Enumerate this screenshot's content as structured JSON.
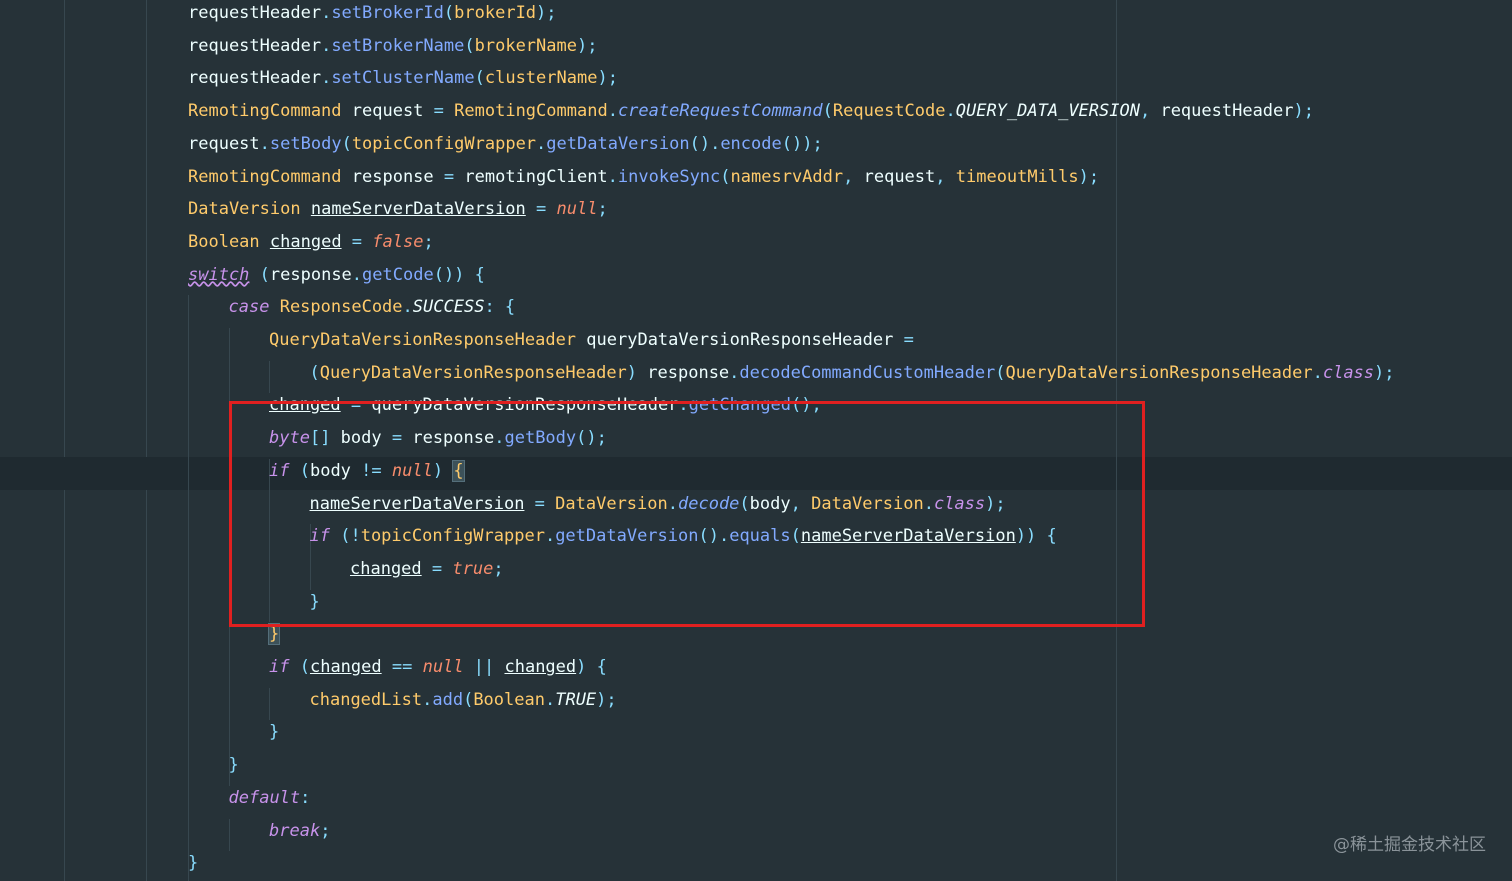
{
  "editor": {
    "lines": [
      [
        [
          "requestHeader",
          "t-plain"
        ],
        [
          ".",
          "t-punc"
        ],
        [
          "setBrokerId",
          "t-meth"
        ],
        [
          "(",
          "t-punc"
        ],
        [
          "brokerId",
          "t-field"
        ],
        [
          ");",
          "t-punc"
        ]
      ],
      [
        [
          "requestHeader",
          "t-plain"
        ],
        [
          ".",
          "t-punc"
        ],
        [
          "setBrokerName",
          "t-meth"
        ],
        [
          "(",
          "t-punc"
        ],
        [
          "brokerName",
          "t-field"
        ],
        [
          ");",
          "t-punc"
        ]
      ],
      [
        [
          "requestHeader",
          "t-plain"
        ],
        [
          ".",
          "t-punc"
        ],
        [
          "setClusterName",
          "t-meth"
        ],
        [
          "(",
          "t-punc"
        ],
        [
          "clusterName",
          "t-field"
        ],
        [
          ");",
          "t-punc"
        ]
      ],
      [
        [
          "RemotingCommand",
          "t-type"
        ],
        [
          " request ",
          "t-plain"
        ],
        [
          "=",
          "t-punc"
        ],
        [
          " ",
          "t-plain"
        ],
        [
          "RemotingCommand",
          "t-type"
        ],
        [
          ".",
          "t-punc"
        ],
        [
          "createRequestCommand",
          "t-meth t-kwital"
        ],
        [
          "(",
          "t-punc"
        ],
        [
          "RequestCode",
          "t-type"
        ],
        [
          ".",
          "t-punc"
        ],
        [
          "QUERY_DATA_VERSION",
          "t-const"
        ],
        [
          ", ",
          "t-punc"
        ],
        [
          "requestHeader",
          "t-plain"
        ],
        [
          ");",
          "t-punc"
        ]
      ],
      [
        [
          "request",
          "t-plain"
        ],
        [
          ".",
          "t-punc"
        ],
        [
          "setBody",
          "t-meth"
        ],
        [
          "(",
          "t-punc"
        ],
        [
          "topicConfigWrapper",
          "t-field"
        ],
        [
          ".",
          "t-punc"
        ],
        [
          "getDataVersion",
          "t-meth"
        ],
        [
          "().",
          "t-punc"
        ],
        [
          "encode",
          "t-meth"
        ],
        [
          "());",
          "t-punc"
        ]
      ],
      [
        [
          "RemotingCommand",
          "t-type"
        ],
        [
          " response ",
          "t-plain"
        ],
        [
          "=",
          "t-punc"
        ],
        [
          " remotingClient",
          "t-plain"
        ],
        [
          ".",
          "t-punc"
        ],
        [
          "invokeSync",
          "t-meth"
        ],
        [
          "(",
          "t-punc"
        ],
        [
          "namesrvAddr",
          "t-field"
        ],
        [
          ", ",
          "t-punc"
        ],
        [
          "request",
          "t-plain"
        ],
        [
          ", ",
          "t-punc"
        ],
        [
          "timeoutMills",
          "t-field"
        ],
        [
          ");",
          "t-punc"
        ]
      ],
      [
        [
          "DataVersion",
          "t-type"
        ],
        [
          " ",
          "t-plain"
        ],
        [
          "nameServerDataVersion",
          "t-plain t-ul"
        ],
        [
          " = ",
          "t-punc"
        ],
        [
          "null",
          "t-lit"
        ],
        [
          ";",
          "t-punc"
        ]
      ],
      [
        [
          "Boolean",
          "t-type"
        ],
        [
          " ",
          "t-plain"
        ],
        [
          "changed",
          "t-plain t-ul"
        ],
        [
          " = ",
          "t-punc"
        ],
        [
          "false",
          "t-lit"
        ],
        [
          ";",
          "t-punc"
        ]
      ],
      [
        [
          "switch",
          "t-kw t-wavy"
        ],
        [
          " (",
          "t-punc"
        ],
        [
          "response",
          "t-plain"
        ],
        [
          ".",
          "t-punc"
        ],
        [
          "getCode",
          "t-meth"
        ],
        [
          "()) {",
          "t-punc"
        ]
      ],
      [
        [
          "case",
          "t-kw"
        ],
        [
          " ",
          "t-plain"
        ],
        [
          "ResponseCode",
          "t-type"
        ],
        [
          ".",
          "t-punc"
        ],
        [
          "SUCCESS",
          "t-const"
        ],
        [
          ": {",
          "t-punc"
        ]
      ],
      [
        [
          "QueryDataVersionResponseHeader",
          "t-type"
        ],
        [
          " queryDataVersionResponseHeader ",
          "t-plain"
        ],
        [
          "=",
          "t-punc"
        ]
      ],
      [
        [
          "(",
          "t-punc"
        ],
        [
          "QueryDataVersionResponseHeader",
          "t-type"
        ],
        [
          ") ",
          "t-punc"
        ],
        [
          "response",
          "t-plain"
        ],
        [
          ".",
          "t-punc"
        ],
        [
          "decodeCommandCustomHeader",
          "t-meth"
        ],
        [
          "(",
          "t-punc"
        ],
        [
          "QueryDataVersionResponseHeader",
          "t-type"
        ],
        [
          ".",
          "t-punc"
        ],
        [
          "class",
          "t-kw"
        ],
        [
          ");",
          "t-punc"
        ]
      ],
      [
        [
          "changed",
          "t-plain t-ul"
        ],
        [
          " = ",
          "t-punc"
        ],
        [
          "queryDataVersionResponseHeader",
          "t-plain"
        ],
        [
          ".",
          "t-punc"
        ],
        [
          "getChanged",
          "t-meth"
        ],
        [
          "();",
          "t-punc"
        ]
      ],
      [
        [
          "byte",
          "t-kw"
        ],
        [
          "[] ",
          "t-punc"
        ],
        [
          "body ",
          "t-plain"
        ],
        [
          "=",
          "t-punc"
        ],
        [
          " response",
          "t-plain"
        ],
        [
          ".",
          "t-punc"
        ],
        [
          "getBody",
          "t-meth"
        ],
        [
          "();",
          "t-punc"
        ]
      ],
      [
        [
          "if",
          "t-kw"
        ],
        [
          " (",
          "t-punc"
        ],
        [
          "body ",
          "t-plain"
        ],
        [
          "!=",
          "t-punc"
        ],
        [
          " ",
          "t-plain"
        ],
        [
          "null",
          "t-lit"
        ],
        [
          ") ",
          "t-punc"
        ],
        [
          "{",
          "t-bracehl"
        ]
      ],
      [
        [
          "nameServerDataVersion",
          "t-plain t-ul"
        ],
        [
          " = ",
          "t-punc"
        ],
        [
          "DataVersion",
          "t-type"
        ],
        [
          ".",
          "t-punc"
        ],
        [
          "decode",
          "t-meth t-kwital"
        ],
        [
          "(",
          "t-punc"
        ],
        [
          "body",
          "t-plain"
        ],
        [
          ", ",
          "t-punc"
        ],
        [
          "DataVersion",
          "t-type"
        ],
        [
          ".",
          "t-punc"
        ],
        [
          "class",
          "t-kw"
        ],
        [
          ");",
          "t-punc"
        ]
      ],
      [
        [
          "if",
          "t-kw"
        ],
        [
          " (!",
          "t-punc"
        ],
        [
          "topicConfigWrapper",
          "t-field"
        ],
        [
          ".",
          "t-punc"
        ],
        [
          "getDataVersion",
          "t-meth"
        ],
        [
          "().",
          "t-punc"
        ],
        [
          "equals",
          "t-meth"
        ],
        [
          "(",
          "t-punc"
        ],
        [
          "nameServerDataVersion",
          "t-plain t-ul"
        ],
        [
          ")) {",
          "t-punc"
        ]
      ],
      [
        [
          "changed",
          "t-plain t-ul"
        ],
        [
          " = ",
          "t-punc"
        ],
        [
          "true",
          "t-lit"
        ],
        [
          ";",
          "t-punc"
        ]
      ],
      [
        [
          "}",
          "t-punc"
        ]
      ],
      [
        [
          "}",
          "t-bracehl"
        ]
      ],
      [
        [
          "if",
          "t-kw"
        ],
        [
          " (",
          "t-punc"
        ],
        [
          "changed",
          "t-plain t-ul"
        ],
        [
          " == ",
          "t-punc"
        ],
        [
          "null",
          "t-lit"
        ],
        [
          " || ",
          "t-punc"
        ],
        [
          "changed",
          "t-plain t-ul"
        ],
        [
          ") {",
          "t-punc"
        ]
      ],
      [
        [
          "changedList",
          "t-field"
        ],
        [
          ".",
          "t-punc"
        ],
        [
          "add",
          "t-meth"
        ],
        [
          "(",
          "t-punc"
        ],
        [
          "Boolean",
          "t-type"
        ],
        [
          ".",
          "t-punc"
        ],
        [
          "TRUE",
          "t-const"
        ],
        [
          ");",
          "t-punc"
        ]
      ],
      [
        [
          "}",
          "t-punc"
        ]
      ],
      [
        [
          "}",
          "t-punc"
        ]
      ],
      [
        [
          "default",
          "t-kw"
        ],
        [
          ":",
          "t-punc"
        ]
      ],
      [
        [
          "break",
          "t-kw"
        ],
        [
          ";",
          "t-punc"
        ]
      ],
      [
        [
          "}",
          "t-punc"
        ]
      ]
    ],
    "indents": [
      0,
      0,
      0,
      0,
      0,
      0,
      0,
      0,
      0,
      1,
      2,
      3,
      2,
      2,
      2,
      3,
      3,
      4,
      3,
      2,
      2,
      3,
      2,
      1,
      1,
      2,
      0
    ]
  },
  "watermark": {
    "text": "@稀土掘金技术社区"
  },
  "colors": {
    "background": "#263238",
    "highlight_box": "#e02020"
  }
}
